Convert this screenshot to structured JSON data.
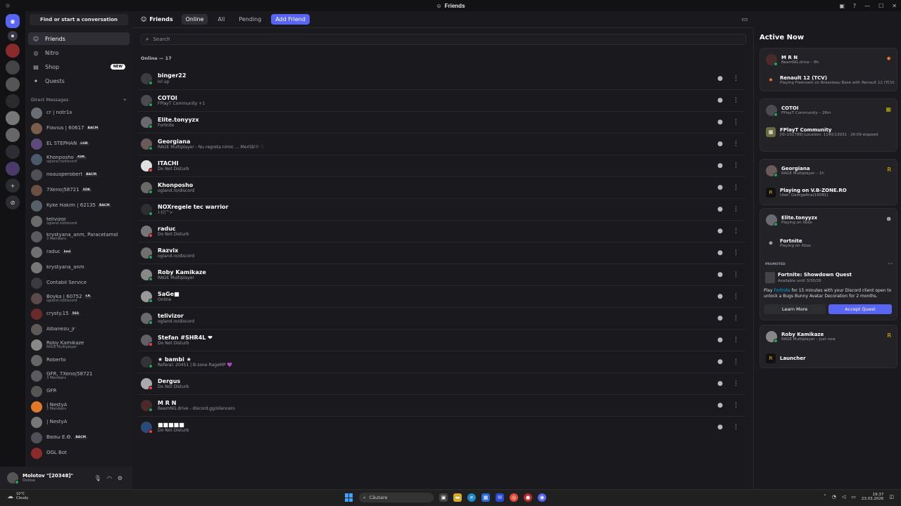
{
  "window": {
    "title": "Friends"
  },
  "sidebar": {
    "find_label": "Find or start a conversation",
    "nav": [
      {
        "label": "Friends",
        "icon": "friends-icon"
      },
      {
        "label": "Nitro",
        "icon": "nitro-icon"
      },
      {
        "label": "Shop",
        "icon": "shop-icon",
        "badge": "NEW"
      },
      {
        "label": "Quests",
        "icon": "quests-icon"
      }
    ],
    "dm_header": "Direct Messages",
    "dm_add": "+",
    "dms": [
      {
        "name": "cr | notr1x",
        "sub": "",
        "tag": "",
        "color": "#6b6e75"
      },
      {
        "name": "Flavius | 60617",
        "sub": "",
        "tag": "BACM",
        "color": "#7a5c4a"
      },
      {
        "name": "EL STEPHAN",
        "sub": "",
        "tag": "LGN",
        "color": "#5d4a7a"
      },
      {
        "name": "Khonposho",
        "sub": "ogland.ro/discord",
        "tag": "XDK",
        "color": "#4a5a6a"
      },
      {
        "name": "noausperobert",
        "sub": "",
        "tag": "BACM",
        "color": "#4f4f55"
      },
      {
        "name": "7Xeno|58721",
        "sub": "",
        "tag": "XDK",
        "color": "#6a5040"
      },
      {
        "name": "Kyke Hakim | 62135",
        "sub": "",
        "tag": "BACM",
        "color": "#55606a"
      },
      {
        "name": "telivizor",
        "sub": "ogland.ro/discord",
        "tag": "",
        "color": "#6a6a6a"
      },
      {
        "name": "krystyana_anm, Paracetamol",
        "sub": "3 Members",
        "tag": "",
        "color": "#5a5a60"
      },
      {
        "name": "raduc",
        "sub": "",
        "tag": "ked",
        "color": "#707070"
      },
      {
        "name": "krystyana_anm",
        "sub": "",
        "tag": "",
        "color": "#777"
      },
      {
        "name": "Contabil Service",
        "sub": "",
        "tag": "",
        "color": "#3a3a40"
      },
      {
        "name": "Boyka | 60752",
        "sub": "ogland.ro/discord",
        "tag": "CK",
        "color": "#5a4a4a"
      },
      {
        "name": "crysty.15",
        "sub": "",
        "tag": "503",
        "color": "#6a2a2a"
      },
      {
        "name": "Albanezu_jr",
        "sub": "",
        "tag": "",
        "color": "#5f5a58"
      },
      {
        "name": "Roby Kamikaze",
        "sub": "RAGE Multiplayer",
        "tag": "",
        "color": "#888"
      },
      {
        "name": "Roberto",
        "sub": "",
        "tag": "",
        "color": "#666"
      },
      {
        "name": "GFR, 7Xeno|58721",
        "sub": "3 Members",
        "tag": "",
        "color": "#5a5a60"
      },
      {
        "name": "GFR",
        "sub": "",
        "tag": "",
        "color": "#555"
      },
      {
        "name": "| NestyA",
        "sub": "2 Members",
        "tag": "",
        "color": "#e07a2a"
      },
      {
        "name": "| NestyA",
        "sub": "",
        "tag": "",
        "color": "#777"
      },
      {
        "name": "Βασω Ε.Θ.",
        "sub": "",
        "tag": "BACM",
        "color": "#505058"
      },
      {
        "name": "OGL Bot",
        "sub": "",
        "tag": "",
        "color": "#8a2a2a"
      }
    ]
  },
  "user": {
    "name": "Molotov \"[20348]\"",
    "status": "Online"
  },
  "topbar": {
    "title": "Friends",
    "tabs": [
      "Online",
      "All",
      "Pending"
    ],
    "add_label": "Add Friend"
  },
  "search": {
    "placeholder": "Search"
  },
  "online_count": "Online — 17",
  "friends": [
    {
      "name": "binger22",
      "sub": "lvl up",
      "status": "#23a55a",
      "color": "#3b3b40"
    },
    {
      "name": "COTOI",
      "sub": "FPlayT Community +1",
      "status": "#23a55a",
      "color": "#4a4a50"
    },
    {
      "name": "Elite.tonyyzx",
      "sub": "Fortnite",
      "status": "#23a55a",
      "color": "#6a6a70"
    },
    {
      "name": "Georgiana",
      "sub": "RAGE Multiplayer - Nu regreta nimic ... Meritâ!!! ♡",
      "status": "#23a55a",
      "color": "#6a5a5a"
    },
    {
      "name": "ITACHI",
      "sub": "Do Not Disturb",
      "status": "#f23f43",
      "color": "#e0e0e0"
    },
    {
      "name": "Khonposho",
      "sub": "ogland.ro/discord",
      "status": "#23a55a",
      "color": "#6a6a6a"
    },
    {
      "name": "NOXregele tec warrior",
      "sub": ")-(((^>",
      "status": "#23a55a",
      "color": "#2e2e33"
    },
    {
      "name": "raduc",
      "sub": "Do Not Disturb",
      "status": "#f23f43",
      "color": "#777"
    },
    {
      "name": "Razvix",
      "sub": "ogland.ro/discord",
      "status": "#23a55a",
      "color": "#707070"
    },
    {
      "name": "Roby Kamikaze",
      "sub": "RAGE Multiplayer",
      "status": "#23a55a",
      "color": "#888"
    },
    {
      "name": "SaGe■",
      "sub": "Online",
      "status": "#23a55a",
      "color": "#999"
    },
    {
      "name": "telivizor",
      "sub": "ogland.ro/discord",
      "status": "#23a55a",
      "color": "#6a6a6a"
    },
    {
      "name": "Stefan #SHR4L ❤",
      "sub": "Do Not Disturb",
      "status": "#f23f43",
      "color": "#606068"
    },
    {
      "name": "★ bambi ★",
      "sub": "Referal: 20451 | B-zone RageMP 💜",
      "status": "#23a55a",
      "color": "#333338"
    },
    {
      "name": "Dergus",
      "sub": "Do Not Disturb",
      "status": "#f23f43",
      "color": "#aaa"
    },
    {
      "name": "M R N",
      "sub": "BeamNG.drive - discord.gg/silencero",
      "status": "#23a55a",
      "color": "#4a2a2a"
    },
    {
      "name": "■■■■■",
      "sub": "Do Not Disturb",
      "status": "#f23f43",
      "color": "#2a4a7a"
    }
  ],
  "active_now": {
    "title": "Active Now",
    "cards": [
      {
        "user": "M R N",
        "user_sub": "BeamNG.drive – 8h",
        "game": "Renault 12 (TCV)",
        "game_sub": "Playing Freeroam on Breasteau Base with Renault 12 (TCV)"
      },
      {
        "user": "COTOI",
        "user_sub": "FPlayT Community – 26m",
        "game": "FPlayT Community",
        "game_sub": "[ID:102788] Location: 1140/13031 · 26:09 elapsed"
      },
      {
        "user": "Georgiana",
        "user_sub": "RAGE Multiplayer – 1h",
        "game": "Playing on V.B-ZONE.RO",
        "game_sub": "User: GeorgeAna(16081)"
      },
      {
        "user": "Elite.tonyyzx",
        "user_sub": "Playing on Xbox",
        "game": "Fortnite",
        "game_sub": "Playing on Xbox"
      },
      {
        "user": "Roby Kamikaze",
        "user_sub": "RAGE Multiplayer – just now",
        "game": "Launcher",
        "game_sub": ""
      }
    ],
    "promo": {
      "label": "PROMOTED",
      "title": "Fortnite: Showdown Quest",
      "available": "Available until 3/30/26",
      "desc_pre": "Play ",
      "desc_link": "Fortnite",
      "desc_post": " for 15 minutes with your Discord client open to unlock a Bugs Bunny Avatar Decoration for 2 months.",
      "learn": "Learn More",
      "accept": "Accept Quest"
    }
  },
  "taskbar": {
    "temp": "10°C",
    "weather": "Cloudy",
    "search": "Căutare",
    "time": "19:37",
    "date": "23.03.2026"
  }
}
